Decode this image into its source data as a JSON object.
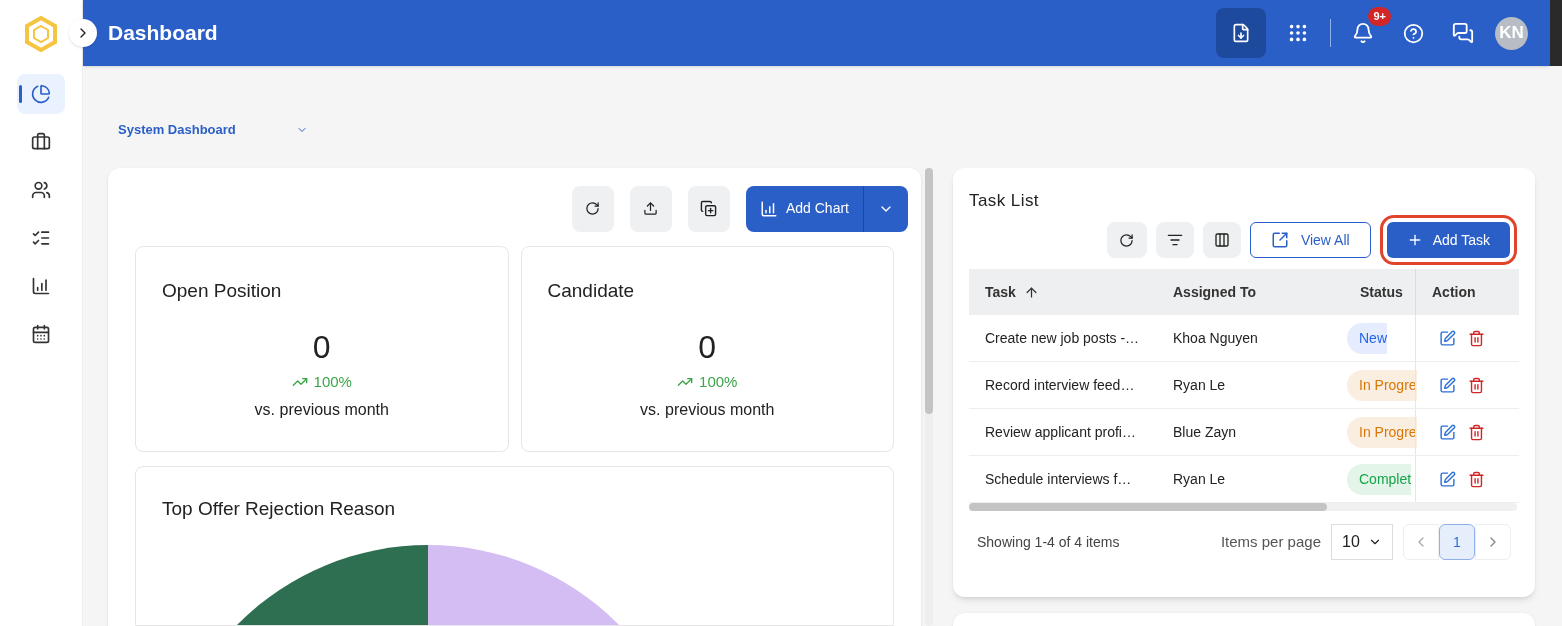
{
  "header": {
    "title": "Dashboard",
    "notifications_badge": "9+",
    "avatar_initials": "KN"
  },
  "sidebar": {
    "items": [
      {
        "selected": true
      },
      {
        "selected": false
      },
      {
        "selected": false
      },
      {
        "selected": false
      },
      {
        "selected": false
      },
      {
        "selected": false
      }
    ]
  },
  "dashboard_select": {
    "value": "System Dashboard"
  },
  "toolbar": {
    "add_chart": "Add Chart"
  },
  "stat_cards": [
    {
      "title": "Open Position",
      "value": "0",
      "change": "100%",
      "caption": "vs. previous month"
    },
    {
      "title": "Candidate",
      "value": "0",
      "change": "100%",
      "caption": "vs. previous month"
    }
  ],
  "chart_card": {
    "title": "Top Offer Rejection Reason"
  },
  "task_list": {
    "title": "Task List",
    "view_all": "View All",
    "add_task": "Add Task",
    "columns": [
      {
        "label": "Task",
        "sorted": true
      },
      {
        "label": "Assigned To",
        "sorted": false
      },
      {
        "label": "Status",
        "sorted": false
      },
      {
        "label": "Action",
        "sorted": false
      }
    ],
    "rows": [
      {
        "task": "Create new job posts -…",
        "assigned_to": "Khoa Nguyen",
        "status": {
          "label": "New",
          "color": "#2563eb"
        }
      },
      {
        "task": "Record interview feed…",
        "assigned_to": "Ryan Le",
        "status": {
          "label": "In Progre",
          "color": "#d97706"
        }
      },
      {
        "task": "Review applicant profi…",
        "assigned_to": "Blue Zayn",
        "status": {
          "label": "In Progre",
          "color": "#d97706"
        }
      },
      {
        "task": "Schedule interviews f…",
        "assigned_to": "Ryan Le",
        "status": {
          "label": "Complet",
          "color": "#16a34a"
        }
      }
    ],
    "summary": "Showing 1-4 of 4 items",
    "per_page_label": "Items per page",
    "per_page": "10",
    "pages": [
      {
        "label": "1",
        "selected": true
      }
    ]
  }
}
